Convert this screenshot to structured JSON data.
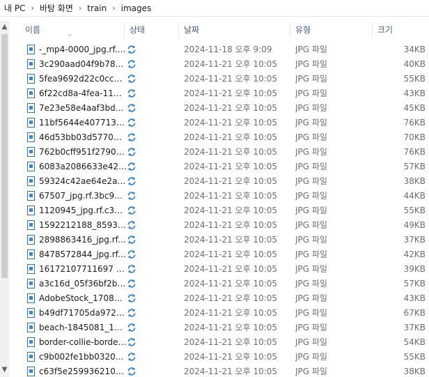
{
  "breadcrumb": [
    "내 PC",
    "바탕 화면",
    "train",
    "images"
  ],
  "columns": {
    "name": "이름",
    "status": "상태",
    "date": "날짜",
    "type": "유형",
    "size": "크기"
  },
  "rows": [
    {
      "name": "-_mp4-0000_jpg.rf.…",
      "date": "2024-11-18 오후 9:09",
      "type": "JPG 파일",
      "size": "34KB"
    },
    {
      "name": "3c290aad04f9b78…",
      "date": "2024-11-21 오후 10:05",
      "type": "JPG 파일",
      "size": "40KB"
    },
    {
      "name": "5fea9692d22c0cc3…",
      "date": "2024-11-21 오후 10:05",
      "type": "JPG 파일",
      "size": "55KB"
    },
    {
      "name": "6f22cd8a-4fea-11e…",
      "date": "2024-11-21 오후 10:05",
      "type": "JPG 파일",
      "size": "43KB"
    },
    {
      "name": "7e23e58e4aaf3bd4…",
      "date": "2024-11-21 오후 10:05",
      "type": "JPG 파일",
      "size": "45KB"
    },
    {
      "name": "11bf5644e407713…",
      "date": "2024-11-21 오후 10:05",
      "type": "JPG 파일",
      "size": "76KB"
    },
    {
      "name": "46d53bb03d57709…",
      "date": "2024-11-21 오후 10:05",
      "type": "JPG 파일",
      "size": "70KB"
    },
    {
      "name": "762b0cff951f2790…",
      "date": "2024-11-21 오후 10:05",
      "type": "JPG 파일",
      "size": "76KB"
    },
    {
      "name": "6083a2086633e42…",
      "date": "2024-11-21 오후 10:05",
      "type": "JPG 파일",
      "size": "57KB"
    },
    {
      "name": "59324c42ae64e2a…",
      "date": "2024-11-21 오후 10:05",
      "type": "JPG 파일",
      "size": "38KB"
    },
    {
      "name": "67507_jpg.rf.3bc9c…",
      "date": "2024-11-21 오후 10:05",
      "type": "JPG 파일",
      "size": "44KB"
    },
    {
      "name": "1120945_jpg.rf.c34…",
      "date": "2024-11-21 오후 10:05",
      "type": "JPG 파일",
      "size": "55KB"
    },
    {
      "name": "1592212188_8593…",
      "date": "2024-11-21 오후 10:05",
      "type": "JPG 파일",
      "size": "49KB"
    },
    {
      "name": "2898863416_jpg.rf.…",
      "date": "2024-11-21 오후 10:05",
      "type": "JPG 파일",
      "size": "37KB"
    },
    {
      "name": "8478572844_jpg.rf.…",
      "date": "2024-11-21 오후 10:05",
      "type": "JPG 파일",
      "size": "42KB"
    },
    {
      "name": "16172107711697 7…",
      "date": "2024-11-21 오후 10:05",
      "type": "JPG 파일",
      "size": "39KB"
    },
    {
      "name": "a3c16d_05f36bf2b…",
      "date": "2024-11-21 오후 10:05",
      "type": "JPG 파일",
      "size": "57KB"
    },
    {
      "name": "AdobeStock_17084…",
      "date": "2024-11-21 오후 10:05",
      "type": "JPG 파일",
      "size": "43KB"
    },
    {
      "name": "b49df71705da972…",
      "date": "2024-11-21 오후 10:05",
      "type": "JPG 파일",
      "size": "67KB"
    },
    {
      "name": "beach-1845081_12…",
      "date": "2024-11-21 오후 10:05",
      "type": "JPG 파일",
      "size": "37KB"
    },
    {
      "name": "border-collie-borde…",
      "date": "2024-11-21 오후 10:05",
      "type": "JPG 파일",
      "size": "54KB"
    },
    {
      "name": "c9b002fe1bb0320…",
      "date": "2024-11-21 오후 10:05",
      "type": "JPG 파일",
      "size": "55KB"
    },
    {
      "name": "c63f5e259936210…",
      "date": "2024-11-21 오후 10:05",
      "type": "JPG 파일",
      "size": "38KB"
    }
  ],
  "colors": {
    "header_text": "#4c607a",
    "meta_text": "#6d6d6d",
    "sync_blue": "#1f7ad6",
    "file_blue": "#2b6fb9"
  },
  "icons": {
    "file": "jpg-file-icon",
    "status": "sync-pending-icon",
    "breadcrumb_separator": "chevron-right-icon"
  }
}
